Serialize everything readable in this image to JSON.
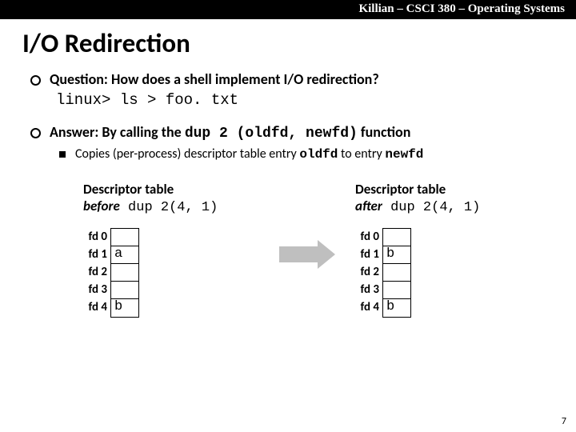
{
  "header": {
    "text": "Killian – CSCI 380 – Operating Systems"
  },
  "title": "I/O Redirection",
  "question": "Question: How does a shell implement I/O redirection?",
  "command": "linux> ls > foo. txt",
  "answer": {
    "prefix": "Answer: By calling the ",
    "code": "dup 2 (oldfd,  newfd)",
    "suffix": "  function"
  },
  "copies": {
    "prefix": "Copies (per-process) descriptor table entry ",
    "code1": "oldfd",
    "mid": " to entry ",
    "code2": "newfd"
  },
  "before": {
    "title1": "Descriptor table",
    "title2_em": "before",
    "title2_code": " dup 2(4, 1)",
    "rows": [
      {
        "label": "fd 0",
        "val": ""
      },
      {
        "label": "fd 1",
        "val": "a"
      },
      {
        "label": "fd 2",
        "val": ""
      },
      {
        "label": "fd 3",
        "val": ""
      },
      {
        "label": "fd 4",
        "val": "b"
      }
    ]
  },
  "after": {
    "title1": "Descriptor table",
    "title2_em": "after",
    "title2_code": " dup 2(4, 1)",
    "rows": [
      {
        "label": "fd 0",
        "val": ""
      },
      {
        "label": "fd 1",
        "val": "b"
      },
      {
        "label": "fd 2",
        "val": ""
      },
      {
        "label": "fd 3",
        "val": ""
      },
      {
        "label": "fd 4",
        "val": "b"
      }
    ]
  },
  "page_number": "7"
}
